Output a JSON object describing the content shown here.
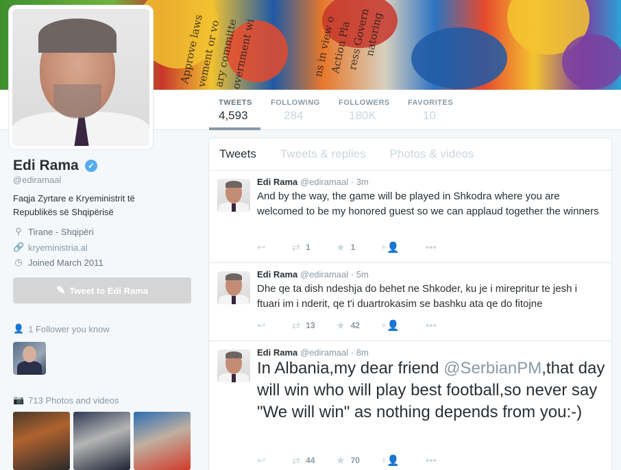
{
  "profile": {
    "name": "Edi Rama",
    "handle": "@ediramaal",
    "bio": "Faqja Zyrtare e Kryeministrit të Republikës së Shqipërisë",
    "location": "Tirane - Shqipëri",
    "website": "kryeministria.al",
    "joined": "Joined March 2011",
    "tweet_to_label": "Tweet to Edi Rama",
    "followers_you_know": "1 Follower you know",
    "photos_videos": "713 Photos and videos"
  },
  "banner_text": [
    "Approve laws",
    "vement or vo",
    "ary committe",
    "overnment wi",
    "ns in view o",
    "Action Pla",
    "ress Govern",
    "natoring"
  ],
  "stats": [
    {
      "label": "TWEETS",
      "value": "4,593"
    },
    {
      "label": "FOLLOWING",
      "value": "284"
    },
    {
      "label": "FOLLOWERS",
      "value": "180K"
    },
    {
      "label": "FAVORITES",
      "value": "10"
    }
  ],
  "timeline": {
    "tabs": [
      "Tweets",
      "Tweets & replies",
      "Photos & videos"
    ],
    "tweets": [
      {
        "name": "Edi Rama",
        "handle": "@ediramaal",
        "time": "3m",
        "text": "And by the way, the game will be played in Shkodra where you are welcomed to be my honored guest so we can applaud together the winners",
        "retweets": "1",
        "favorites": "1"
      },
      {
        "name": "Edi Rama",
        "handle": "@ediramaal",
        "time": "5m",
        "text": "Dhe qe ta dish ndeshja do behet ne Shkoder, ku je i mirepritur te jesh i ftuari im i nderit, qe t'i duartrokasim se bashku ata qe do fitojne",
        "retweets": "13",
        "favorites": "42"
      },
      {
        "name": "Edi Rama",
        "handle": "@ediramaal",
        "time": "8m",
        "text_before": "In Albania,my dear friend ",
        "mention": "@SerbianPM",
        "text_after": ",that day will win who will play best football,so never say \"We will win\" as nothing depends from you:-)",
        "retweets": "44",
        "favorites": "70"
      }
    ]
  },
  "icons": {
    "verified": "verified-badge-icon",
    "location": "location-pin-icon",
    "link": "link-icon",
    "calendar": "clock-icon",
    "reply": "reply-icon",
    "retweet": "retweet-icon",
    "favorite": "star-icon",
    "follow": "follow-icon",
    "more": "more-icon"
  },
  "colors": {
    "accent": "#55acee",
    "muted": "#8899a6",
    "text": "#292f33"
  }
}
